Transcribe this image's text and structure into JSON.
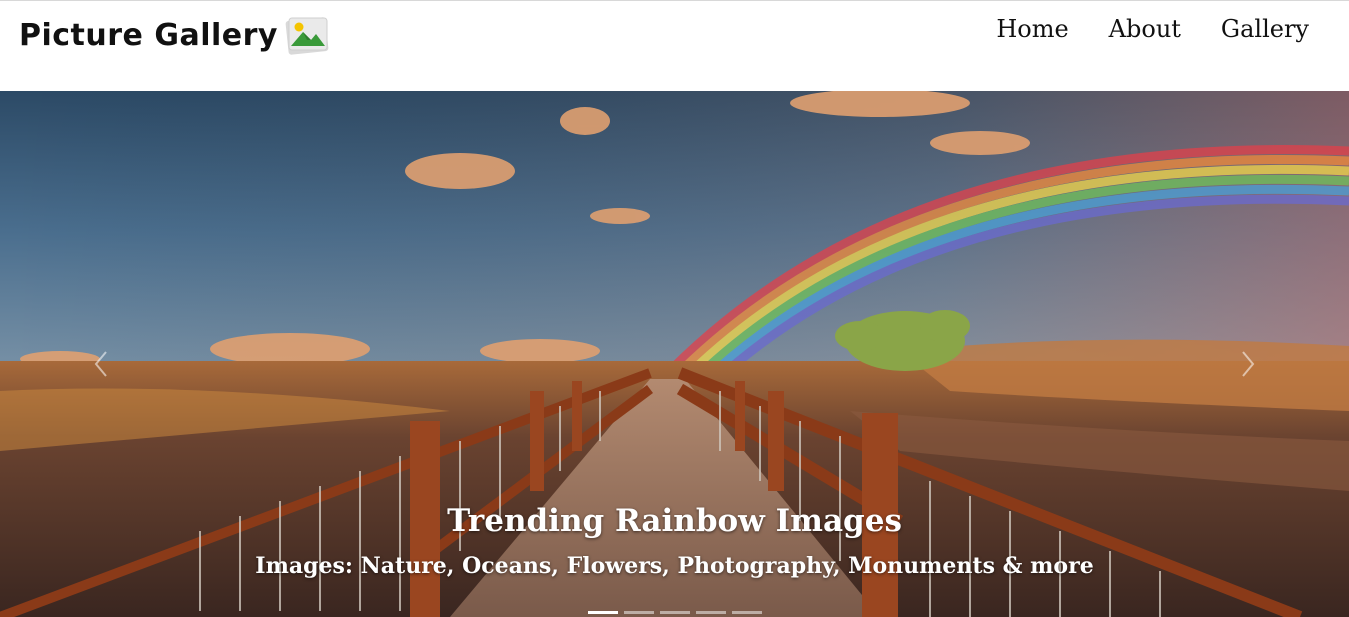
{
  "brand": {
    "title": "Picture Gallery",
    "icon": "landscape-image-icon"
  },
  "nav": {
    "items": [
      {
        "label": "Home"
      },
      {
        "label": "About"
      },
      {
        "label": "Gallery"
      }
    ]
  },
  "carousel": {
    "slide_title": "Trending Rainbow Images",
    "slide_subtitle": "Images: Nature, Oceans, Flowers, Photography, Monuments & more",
    "prev_icon": "chevron-left-icon",
    "next_icon": "chevron-right-icon",
    "slide_count": 5,
    "active_slide": 1
  }
}
